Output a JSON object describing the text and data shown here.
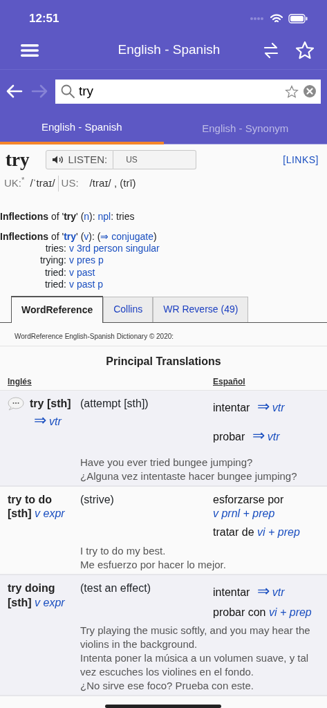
{
  "status_bar": {
    "time": "12:51"
  },
  "header": {
    "title": "English - Spanish"
  },
  "nav": {
    "back": {
      "disabled": false
    },
    "forward": {
      "disabled": true
    }
  },
  "search": {
    "value": "try"
  },
  "dict_tabs": [
    {
      "label": "English - Spanish",
      "selected": true
    },
    {
      "label": "English - Synonym",
      "selected": false
    }
  ],
  "entry": {
    "headword": "try",
    "listen_label": "LISTEN:",
    "listen_region": "US",
    "links": "[LINKS]"
  },
  "pronunciation": {
    "uk_label": "UK:$^{*}$",
    "uk_ipa": "/ˈtraɪ/",
    "us_label": "US:",
    "us_ipa": "/traɪ/ , (trī)"
  },
  "inflections": [
    {
      "segments": [
        {
          "kind": "text",
          "text": "**Inflections** of '**try**' ("
        },
        {
          "kind": "link",
          "text": "n"
        },
        {
          "kind": "text",
          "text": "): "
        },
        {
          "kind": "link",
          "text": "npl"
        },
        {
          "kind": "text",
          "text": ": tries"
        }
      ]
    },
    {
      "segments": [
        {
          "kind": "text",
          "text": "**Inflections** of '"
        },
        {
          "kind": "link",
          "text": "**try**"
        },
        {
          "kind": "text",
          "text": "' ("
        },
        {
          "kind": "link",
          "text": "v"
        },
        {
          "kind": "text",
          "text": "): ("
        },
        {
          "kind": "link",
          "text": "⇒ conjugate"
        },
        {
          "kind": "text",
          "text": ")"
        }
      ]
    }
  ],
  "forms": [
    {
      "form": "tries:",
      "tag": "v 3rd person singular"
    },
    {
      "form": "trying:",
      "tag": "v pres p"
    },
    {
      "form": "tried:",
      "tag": "v past"
    },
    {
      "form": "tried:",
      "tag": "v past p"
    }
  ],
  "source_tabs": [
    {
      "label": "WordReference",
      "selected": true
    },
    {
      "label": "Collins",
      "selected": false
    },
    {
      "label": "WR Reverse (49)",
      "selected": false
    }
  ],
  "copyright": "WordReference English-Spanish Dictionary © 2020:",
  "section_title": "Principal Translations",
  "columns": [
    "Inglés",
    "Español"
  ],
  "rows": [
    {
      "forum_icon": true,
      "term": "try [sth]",
      "arrow": "⇒",
      "pos": "vtr",
      "sense": "(attempt [sth])",
      "translations": [
        {
          "word": "intentar",
          "arrow": "⇒",
          "pos": "vtr"
        },
        {
          "word": "probar",
          "arrow": "⇒",
          "pos": "vtr"
        }
      ],
      "examples": [
        "Have you ever tried bungee jumping?",
        "¿Alguna vez intentaste hacer bungee jumping?"
      ]
    },
    {
      "forum_icon": false,
      "term": "try to do [sth]",
      "pos": "v expr",
      "sense": "(strive)",
      "translations": [
        {
          "word": "esforzarse por",
          "pos": "v prnl + prep"
        },
        {
          "word": "tratar de",
          "pos": "vi + prep"
        }
      ],
      "examples": [
        "I try to do my best.",
        "Me esfuerzo por hacer lo mejor."
      ]
    },
    {
      "forum_icon": false,
      "term": "try doing [sth]",
      "pos": "v expr",
      "sense": "(test an effect)",
      "translations": [
        {
          "word": "intentar",
          "arrow": "⇒",
          "pos": "vtr"
        },
        {
          "word": "probar con",
          "pos": "vi + prep"
        }
      ],
      "examples": [
        "Try playing the music softly, and you may hear the violins in the background.",
        "Intenta poner la música a un volumen suave, y tal vez escuches los violines en el fondo.",
        "¿No sirve ese foco? Prueba con este."
      ]
    }
  ]
}
